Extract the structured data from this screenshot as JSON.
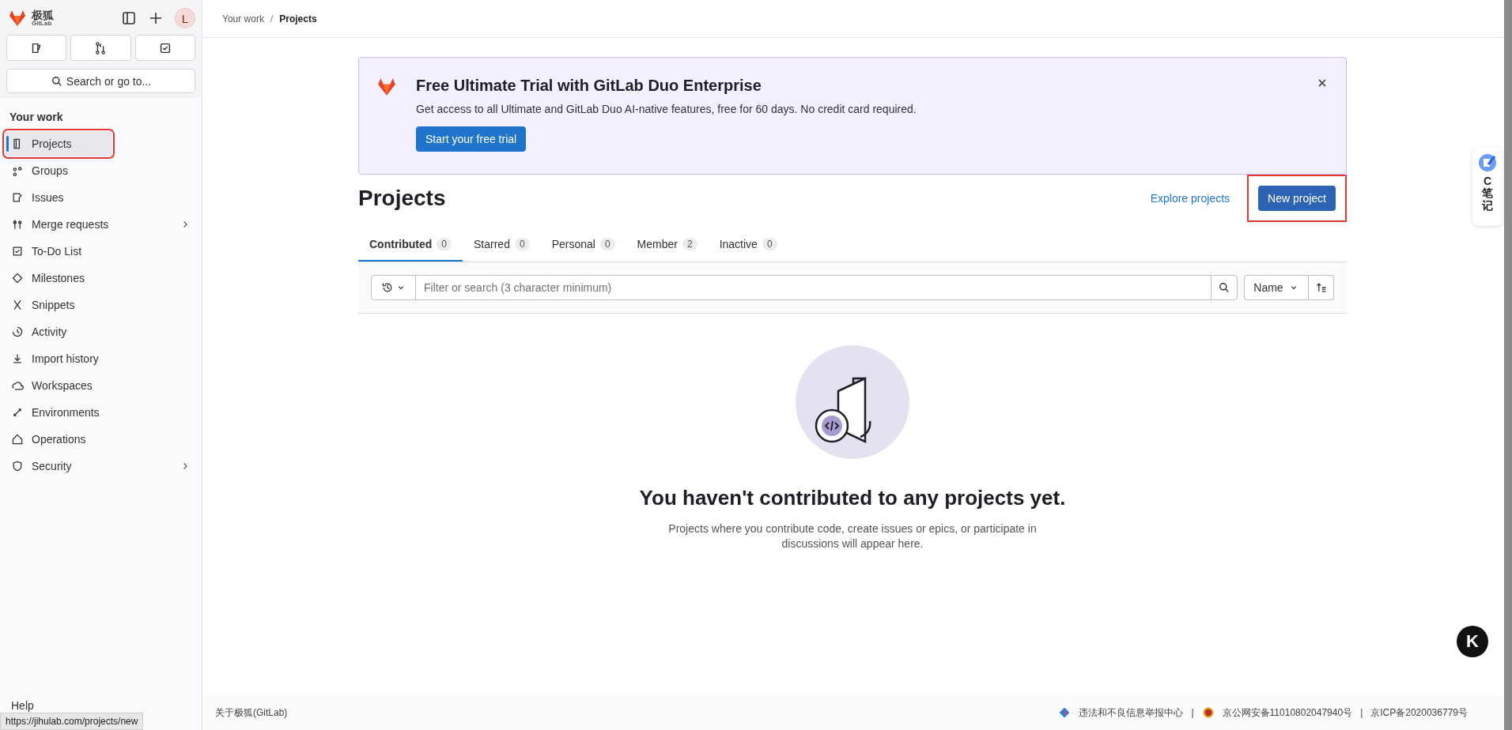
{
  "sidebar": {
    "brand": "极狐",
    "brand_sub": "GitLab",
    "avatar": "L",
    "search_placeholder": "Search or go to...",
    "section": "Your work",
    "items": [
      {
        "label": "Projects",
        "selected": true,
        "highlighted": true,
        "expandable": false
      },
      {
        "label": "Groups",
        "selected": false,
        "highlighted": false,
        "expandable": false
      },
      {
        "label": "Issues",
        "selected": false,
        "highlighted": false,
        "expandable": false
      },
      {
        "label": "Merge requests",
        "selected": false,
        "highlighted": false,
        "expandable": true
      },
      {
        "label": "To-Do List",
        "selected": false,
        "highlighted": false,
        "expandable": false
      },
      {
        "label": "Milestones",
        "selected": false,
        "highlighted": false,
        "expandable": false
      },
      {
        "label": "Snippets",
        "selected": false,
        "highlighted": false,
        "expandable": false
      },
      {
        "label": "Activity",
        "selected": false,
        "highlighted": false,
        "expandable": false
      },
      {
        "label": "Import history",
        "selected": false,
        "highlighted": false,
        "expandable": false
      },
      {
        "label": "Workspaces",
        "selected": false,
        "highlighted": false,
        "expandable": false
      },
      {
        "label": "Environments",
        "selected": false,
        "highlighted": false,
        "expandable": false
      },
      {
        "label": "Operations",
        "selected": false,
        "highlighted": false,
        "expandable": false
      },
      {
        "label": "Security",
        "selected": false,
        "highlighted": false,
        "expandable": true
      }
    ],
    "help": "Help"
  },
  "status_url": "https://jihulab.com/projects/new",
  "breadcrumb": [
    "Your work",
    "Projects"
  ],
  "breadcrumb_separator": "/",
  "banner": {
    "title": "Free Ultimate Trial with GitLab Duo Enterprise",
    "text": "Get access to all Ultimate and GitLab Duo AI-native features, free for 60 days. No credit card required.",
    "button": "Start your free trial"
  },
  "page_title": "Projects",
  "explore_link": "Explore projects",
  "new_button": {
    "label": "New project",
    "highlighted": true
  },
  "tabs": [
    {
      "label": "Contributed",
      "count": "0",
      "selected": true
    },
    {
      "label": "Starred",
      "count": "0",
      "selected": false
    },
    {
      "label": "Personal",
      "count": "0",
      "selected": false
    },
    {
      "label": "Member",
      "count": "2",
      "selected": false
    },
    {
      "label": "Inactive",
      "count": "0",
      "selected": false
    }
  ],
  "filter": {
    "placeholder": "Filter or search (3 character minimum)",
    "sort": "Name"
  },
  "empty_state": {
    "title": "You haven't contributed to any projects yet.",
    "text": "Projects where you contribute code, create issues or epics, or participate in discussions will appear here."
  },
  "footer": {
    "about": "关于极狐(GitLab)",
    "separator": "|",
    "links": [
      "违法和不良信息举报中心",
      "京公网安备11010802047940号",
      "京ICP备2020036779号"
    ]
  },
  "side_widget": {
    "label": "C笔记",
    "avatar": "K"
  }
}
